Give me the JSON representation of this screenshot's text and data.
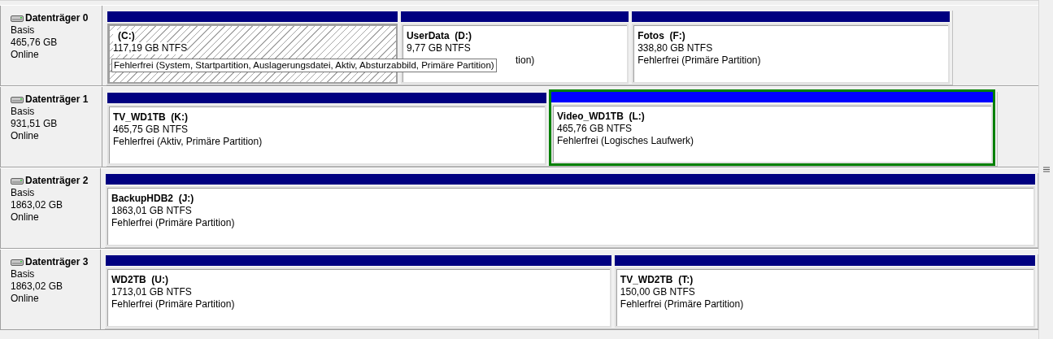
{
  "disks": [
    {
      "name": "Datenträger 0",
      "type": "Basis",
      "size": "465,76 GB",
      "status": "Online",
      "partitions": [
        {
          "kind": "primary",
          "label": "(C:)",
          "size": "117,19 GB NTFS",
          "status": "Fehlerfrei (System, Startpartition, Auslagerungsdatei, Aktiv, Absturzabbild, Primäre Partition)",
          "selected": true,
          "focused": false,
          "tooltip": true
        },
        {
          "kind": "primary",
          "label": "UserData  (D:)",
          "size": "9,77 GB NTFS",
          "status": "tion)",
          "selected": false,
          "focused": false,
          "covered": true
        },
        {
          "kind": "primary",
          "label": "Fotos  (F:)",
          "size": "338,80 GB NTFS",
          "status": "Fehlerfrei (Primäre Partition)",
          "selected": false,
          "focused": false
        }
      ]
    },
    {
      "name": "Datenträger 1",
      "type": "Basis",
      "size": "931,51 GB",
      "status": "Online",
      "partitions": [
        {
          "kind": "primary",
          "label": "TV_WD1TB  (K:)",
          "size": "465,75 GB NTFS",
          "status": "Fehlerfrei (Aktiv, Primäre Partition)",
          "selected": false,
          "focused": false
        },
        {
          "kind": "logical",
          "label": "Video_WD1TB  (L:)",
          "size": "465,76 GB NTFS",
          "status": "Fehlerfrei (Logisches Laufwerk)",
          "selected": false,
          "focused": true
        }
      ]
    },
    {
      "name": "Datenträger 2",
      "type": "Basis",
      "size": "1863,02 GB",
      "status": "Online",
      "partitions": [
        {
          "kind": "primary",
          "label": "BackupHDB2  (J:)",
          "size": "1863,01 GB NTFS",
          "status": "Fehlerfrei (Primäre Partition)",
          "selected": false,
          "focused": false
        }
      ]
    },
    {
      "name": "Datenträger 3",
      "type": "Basis",
      "size": "1863,02 GB",
      "status": "Online",
      "partitions": [
        {
          "kind": "primary",
          "label": "WD2TB  (U:)",
          "size": "1713,01 GB NTFS",
          "status": "Fehlerfrei (Primäre Partition)",
          "selected": false,
          "focused": false
        },
        {
          "kind": "primary",
          "label": "TV_WD2TB  (T:)",
          "size": "150,00 GB NTFS",
          "status": "Fehlerfrei (Primäre Partition)",
          "selected": false,
          "focused": false
        }
      ]
    }
  ]
}
